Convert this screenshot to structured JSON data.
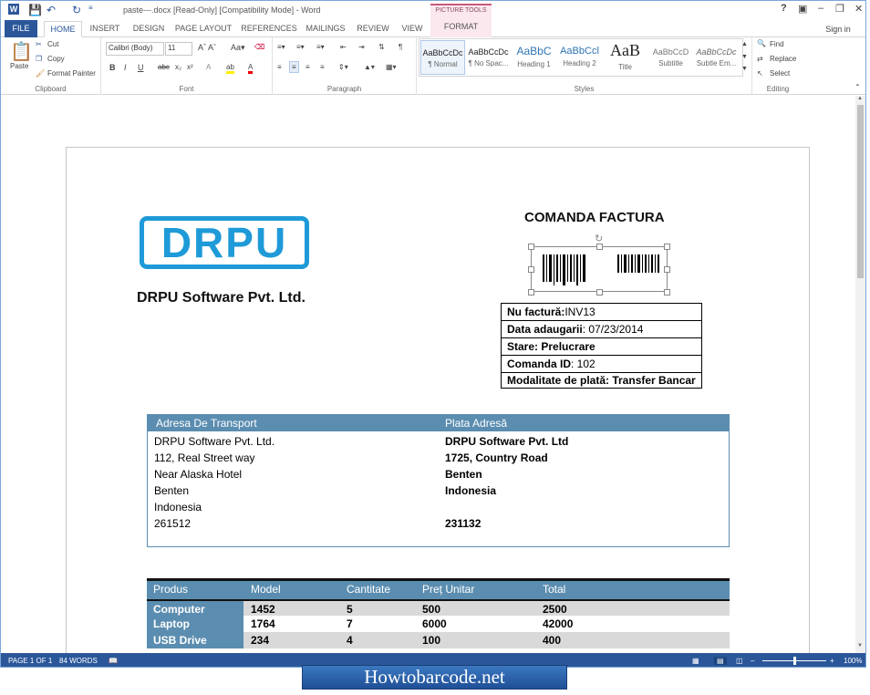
{
  "app": {
    "title": "paste---.docx [Read-Only] [Compatibility Mode] - Word",
    "sign_in": "Sign in"
  },
  "tabs": [
    "FILE",
    "HOME",
    "INSERT",
    "DESIGN",
    "PAGE LAYOUT",
    "REFERENCES",
    "MAILINGS",
    "REVIEW",
    "VIEW"
  ],
  "picture_tools": {
    "label": "PICTURE TOOLS",
    "format": "FORMAT"
  },
  "clipboard": {
    "paste": "Paste",
    "cut": "Cut",
    "copy": "Copy",
    "format_painter": "Format Painter",
    "label": "Clipboard"
  },
  "font": {
    "name": "Calibri (Body)",
    "size": "11",
    "label": "Font"
  },
  "paragraph": {
    "label": "Paragraph"
  },
  "styles": {
    "label": "Styles",
    "items": [
      {
        "preview": "AaBbCcDc",
        "name": "¶ Normal"
      },
      {
        "preview": "AaBbCcDc",
        "name": "¶ No Spac..."
      },
      {
        "preview": "AaBbC",
        "name": "Heading 1"
      },
      {
        "preview": "AaBbCcl",
        "name": "Heading 2"
      },
      {
        "preview": "AaB",
        "name": "Title"
      },
      {
        "preview": "AaBbCcD",
        "name": "Subtitle"
      },
      {
        "preview": "AaBbCcDc",
        "name": "Subtle Em..."
      }
    ]
  },
  "editing": {
    "find": "Find",
    "replace": "Replace",
    "select": "Select",
    "label": "Editing"
  },
  "doc": {
    "logo_text": "DRPU",
    "company": "DRPU Software Pvt. Ltd.",
    "order_title": "COMANDA FACTURA",
    "info": [
      {
        "label": "Nu factură:",
        "value": "INV13"
      },
      {
        "label": "Data adaugarii",
        "value": ": 07/23/2014"
      },
      {
        "label": "Stare: Prelucrare",
        "value": ""
      },
      {
        "label": "Comanda ID",
        "value": ": 102"
      },
      {
        "label": "Modalitate de plată: Transfer Bancar",
        "value": ""
      }
    ],
    "shipping_header": "Adresa De Transport",
    "billing_header": "Plata Adresă",
    "shipping": [
      "DRPU Software Pvt. Ltd.",
      "112, Real Street way",
      "Near Alaska Hotel",
      "Benten",
      "Indonesia",
      "261512"
    ],
    "billing": [
      "DRPU Software Pvt. Ltd",
      "1725, Country Road",
      "Benten",
      "Indonesia",
      "",
      "231132"
    ],
    "product_headers": [
      "Produs",
      "Model",
      "Cantitate",
      "Preț Unitar",
      "Total"
    ],
    "products": [
      [
        "Computer",
        "1452",
        "5",
        "500",
        "2500"
      ],
      [
        "Laptop",
        "1764",
        "7",
        "6000",
        "42000"
      ],
      [
        "USB Drive",
        "234",
        "4",
        "100",
        "400"
      ]
    ]
  },
  "status": {
    "page": "PAGE 1 OF 1",
    "words": "84 WORDS",
    "zoom": "100%"
  },
  "banner": "Howtobarcode.net"
}
